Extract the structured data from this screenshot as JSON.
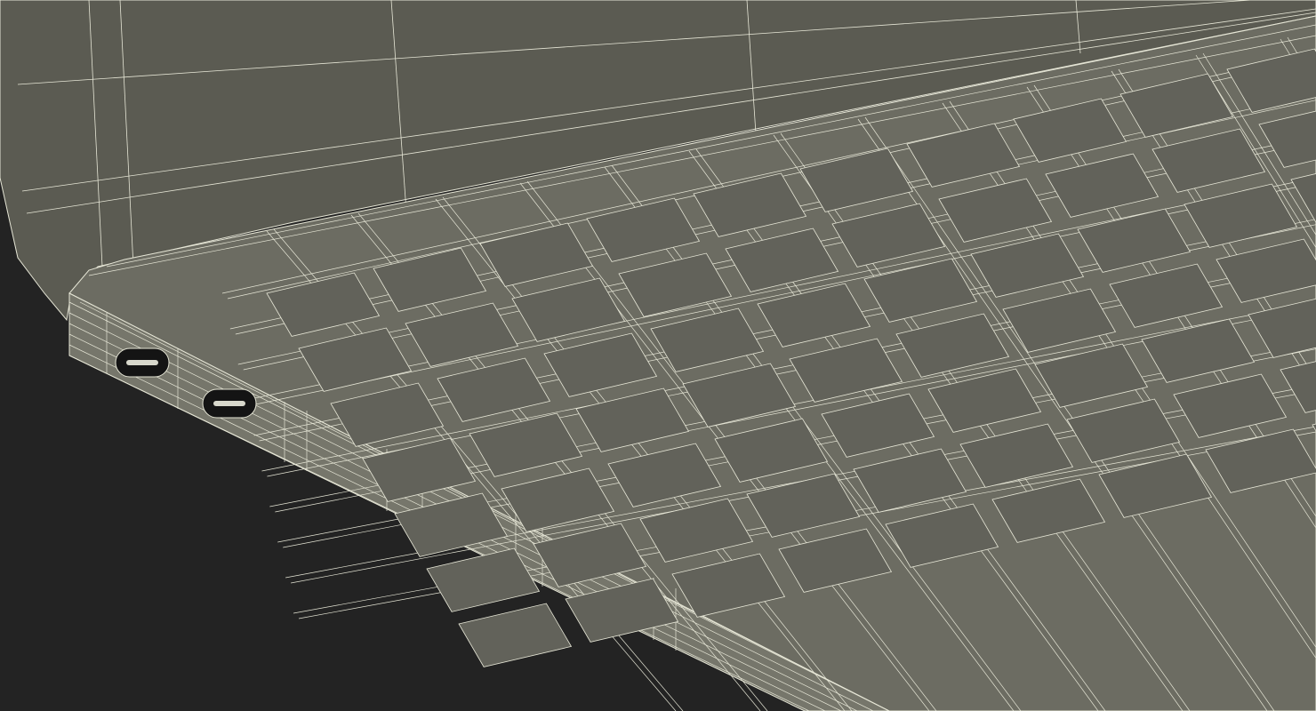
{
  "scene": {
    "subject": "laptop-wireframe-render",
    "colors": {
      "background": "#232323",
      "lid_fill": "#5b5b52",
      "base_fill": "#6c6c62",
      "edge_fill": "#76766b",
      "key_fill": "#62625a",
      "wire": "#e6e6d6",
      "port_fill": "#141414",
      "port_pin": "#d8d8cc"
    },
    "ports": [
      {
        "name": "usb-c-port-1"
      },
      {
        "name": "usb-c-port-2"
      }
    ],
    "keyboard": {
      "rows": 7,
      "columns": 11
    }
  }
}
